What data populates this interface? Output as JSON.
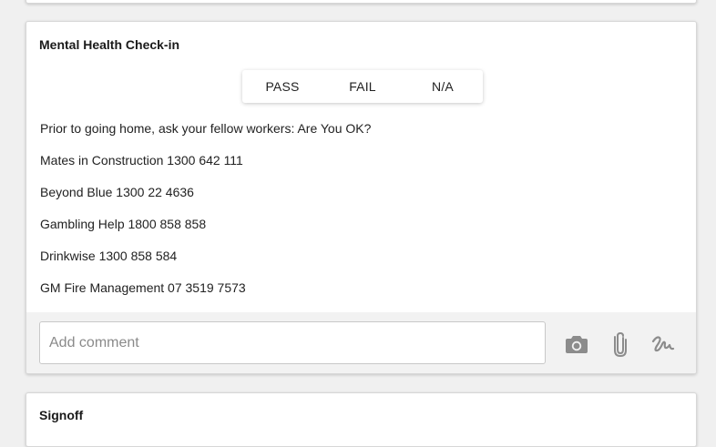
{
  "section": {
    "title": "Mental Health Check-in",
    "options": [
      "PASS",
      "FAIL",
      "N/A"
    ],
    "lines": [
      "Prior to going home, ask your fellow workers: Are You OK?",
      "Mates in Construction 1300 642 111",
      "Beyond Blue 1300 22 4636",
      "Gambling Help 1800 858 858",
      "Drinkwise 1300 858 584",
      "GM Fire Management 07 3519 7573"
    ],
    "comment": {
      "placeholder": "Add comment",
      "value": ""
    },
    "tools": [
      "camera-icon",
      "paperclip-icon",
      "signature-icon"
    ]
  },
  "next_section": {
    "title": "Signoff"
  },
  "colors": {
    "background": "#f0f0f0",
    "card": "#ffffff",
    "footer": "#f2f2f2",
    "icon": "#8c8c8c"
  }
}
